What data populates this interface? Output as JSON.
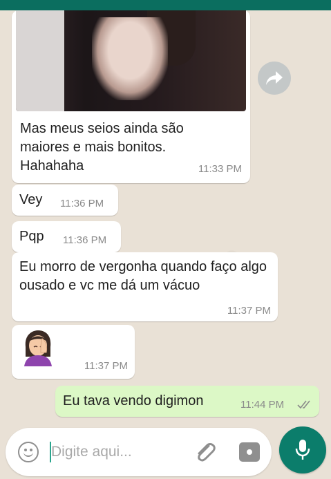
{
  "colors": {
    "header": "#0b6e5f",
    "chat_background": "#e9e1d6",
    "incoming_bubble": "#ffffff",
    "outgoing_bubble": "#dcf8c6",
    "mic_button": "#0b7d6b",
    "read_ticks": "#8a8a8a"
  },
  "messages": [
    {
      "type": "image",
      "direction": "incoming",
      "text": "Mas meus seios ainda são maiores e mais bonitos. Hahahaha",
      "time": "11:33 PM"
    },
    {
      "type": "text",
      "direction": "incoming",
      "text": "Vey",
      "time": "11:36 PM"
    },
    {
      "type": "text",
      "direction": "incoming",
      "text": "Pqp",
      "time": "11:36 PM"
    },
    {
      "type": "text",
      "direction": "incoming",
      "text": "Eu morro de vergonha quando faço algo ousado e vc me dá um vácuo",
      "time": "11:37 PM"
    },
    {
      "type": "emoji",
      "direction": "incoming",
      "emoji": "face-palm-woman-emoji",
      "time": "11:37 PM"
    },
    {
      "type": "text",
      "direction": "outgoing",
      "text": "Eu tava vendo digimon",
      "time": "11:44 PM",
      "status": "read"
    }
  ],
  "input": {
    "placeholder": "Digite aqui...",
    "value": ""
  },
  "icons": {
    "forward": "forward-icon",
    "emoji": "smiley-icon",
    "attach": "paperclip-icon",
    "camera": "camera-icon",
    "mic": "microphone-icon"
  }
}
